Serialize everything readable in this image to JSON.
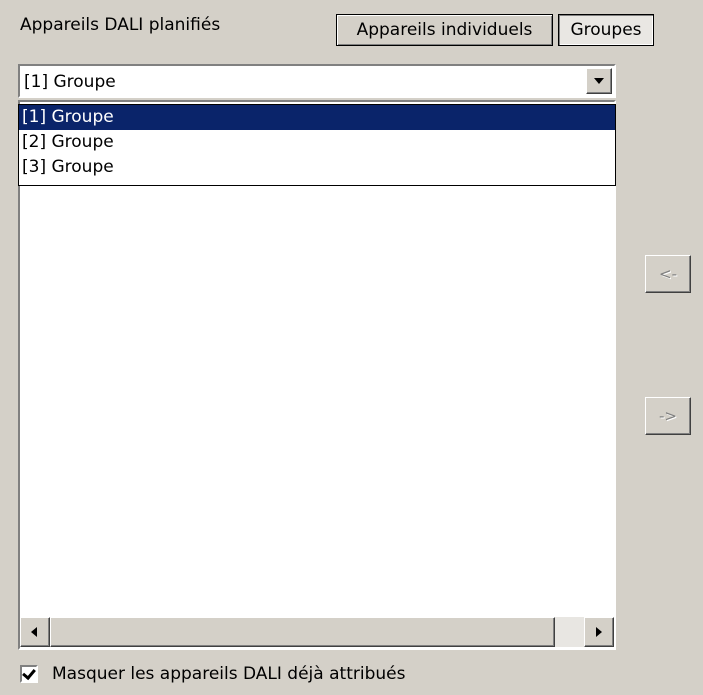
{
  "header": {
    "title": "Appareils DALI planifiés"
  },
  "toggle": {
    "individual_label": "Appareils individuels",
    "groups_label": "Groupes",
    "active": "groups"
  },
  "group_select": {
    "selected_value": "[1] Groupe",
    "options": [
      "[1] Groupe",
      "[2] Groupe",
      "[3] Groupe"
    ],
    "highlighted_index": 0
  },
  "transfer": {
    "left_label": "<-",
    "right_label": "->"
  },
  "hide_assigned": {
    "label": "Masquer les appareils DALI déjà attribués",
    "checked": true
  },
  "icons": {
    "dropdown": "chevron-down-icon",
    "scroll_left": "arrow-left-icon",
    "scroll_right": "arrow-right-icon",
    "check": "checkmark-icon"
  },
  "colors": {
    "selection": "#0a246a",
    "face": "#d4d0c8"
  }
}
